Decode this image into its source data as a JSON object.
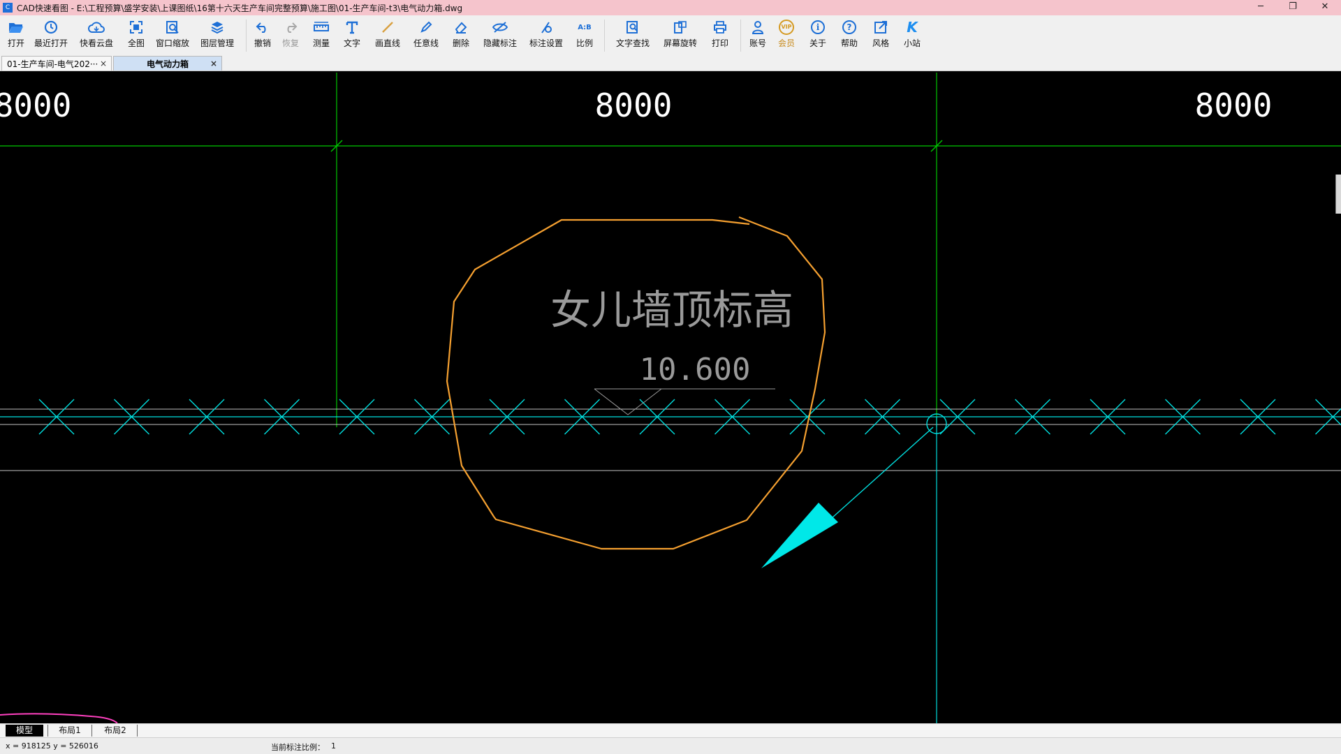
{
  "window": {
    "title": "CAD快速看图 - E:\\工程预算\\盛学安装\\上课图纸\\16第十六天生产车间完整预算\\施工图\\01-生产车间-t3\\电气动力箱.dwg",
    "app_icon_text": "C",
    "controls": {
      "minimize": "─",
      "restore": "❐",
      "close": "✕"
    }
  },
  "toolbar": {
    "items": [
      {
        "key": "open",
        "label": "打开",
        "icon": "folder-open-icon"
      },
      {
        "key": "recent",
        "label": "最近打开",
        "icon": "history-icon"
      },
      {
        "key": "cloud",
        "label": "快看云盘",
        "icon": "cloud-icon"
      },
      {
        "key": "full",
        "label": "全图",
        "icon": "fit-all-icon"
      },
      {
        "key": "zoom",
        "label": "窗口缩放",
        "icon": "zoom-window-icon"
      },
      {
        "key": "layers",
        "label": "图层管理",
        "icon": "layers-icon"
      },
      {
        "key": "undo",
        "label": "撤销",
        "icon": "undo-icon"
      },
      {
        "key": "redo",
        "label": "恢复",
        "icon": "redo-icon",
        "disabled": true
      },
      {
        "key": "measure",
        "label": "测量",
        "icon": "measure-icon"
      },
      {
        "key": "text",
        "label": "文字",
        "icon": "text-icon"
      },
      {
        "key": "line",
        "label": "画直线",
        "icon": "line-icon"
      },
      {
        "key": "freehand",
        "label": "任意线",
        "icon": "pen-icon"
      },
      {
        "key": "delete",
        "label": "删除",
        "icon": "eraser-icon"
      },
      {
        "key": "hide",
        "label": "隐藏标注",
        "icon": "eye-hide-icon"
      },
      {
        "key": "dimset",
        "label": "标注设置",
        "icon": "dimension-settings-icon"
      },
      {
        "key": "scale",
        "label": "比例",
        "icon": "scale-icon",
        "icon_text": "A:B"
      },
      {
        "key": "find",
        "label": "文字查找",
        "icon": "text-search-icon"
      },
      {
        "key": "rotate",
        "label": "屏幕旋转",
        "icon": "rotate-screen-icon"
      },
      {
        "key": "print",
        "label": "打印",
        "icon": "printer-icon"
      },
      {
        "key": "account",
        "label": "账号",
        "icon": "user-icon"
      },
      {
        "key": "vip",
        "label": "会员",
        "icon": "vip-icon",
        "icon_text": "VIP"
      },
      {
        "key": "about",
        "label": "关于",
        "icon": "info-icon",
        "icon_text": "i"
      },
      {
        "key": "help",
        "label": "帮助",
        "icon": "help-icon",
        "icon_text": "?"
      },
      {
        "key": "style",
        "label": "风格",
        "icon": "style-icon"
      },
      {
        "key": "station",
        "label": "小站",
        "icon": "k-logo-icon",
        "icon_text": "K"
      }
    ]
  },
  "tabs": [
    {
      "label": "01-生产车间-电气202···",
      "close": "×",
      "active": false
    },
    {
      "label": "电气动力箱",
      "close": "×",
      "active": true
    }
  ],
  "drawing": {
    "dimension_labels": [
      "8000",
      "8000",
      "8000"
    ],
    "annotation_text": "女儿墙顶标高",
    "elevation_text": "10.600",
    "colors": {
      "background": "#000000",
      "grid": "#00c800",
      "cloud": "#f5a030",
      "axis": "#00dede",
      "text": "#9a9a9a",
      "wall": "#c0c0c0",
      "markup": "#ff40c0"
    }
  },
  "layout_tabs": [
    "模型",
    "布局1",
    "布局2"
  ],
  "status": {
    "coordinates": "x = 918125  y = 526016",
    "scale_label": "当前标注比例：",
    "scale_value": "1"
  }
}
